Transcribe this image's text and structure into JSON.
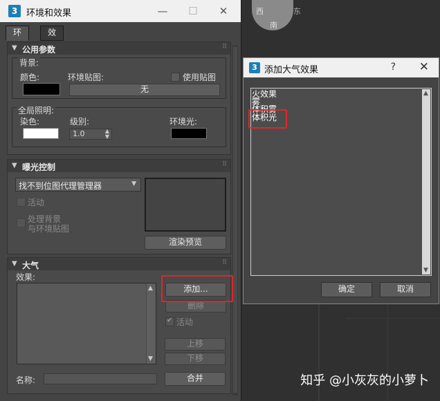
{
  "main_window": {
    "title": "环境和效果",
    "tabs": [
      {
        "label": "环境"
      },
      {
        "label": "效果"
      }
    ],
    "common_params": {
      "header": "公用参数",
      "background_label": "背景:",
      "color_label": "颜色:",
      "env_map_label": "环境贴图:",
      "use_map_label": "使用贴图",
      "map_button": "无",
      "global_lighting_label": "全局照明:",
      "tint_label": "染色:",
      "level_label": "级别:",
      "level_value": "1.0",
      "ambient_label": "环境光:",
      "colors": {
        "background": "#000000",
        "tint": "#ffffff",
        "ambient": "#000000"
      }
    },
    "exposure": {
      "header": "曝光控制",
      "dropdown_value": "找不到位图代理管理器",
      "active_label": "活动",
      "process_bg_label_1": "处理背景",
      "process_bg_label_2": "与环境贴图",
      "render_preview_button": "渲染预览"
    },
    "atmosphere": {
      "header": "大气",
      "effects_label": "效果:",
      "add_button": "添加...",
      "delete_button": "删除",
      "active_label": "活动",
      "move_up_button": "上移",
      "move_down_button": "下移",
      "name_label": "名称:",
      "merge_button": "合并"
    }
  },
  "dialog": {
    "title": "添加大气效果",
    "help": "?",
    "close": "✕",
    "items": [
      {
        "label": "火效果"
      },
      {
        "label": "雾"
      },
      {
        "label": "体积雾"
      },
      {
        "label": "体积光"
      }
    ],
    "ok_button": "确定",
    "cancel_button": "取消"
  },
  "viewport": {
    "compass_labels": [
      "南",
      "东",
      "西"
    ],
    "overlay_text": "知乎 @小灰灰的小萝卜"
  }
}
